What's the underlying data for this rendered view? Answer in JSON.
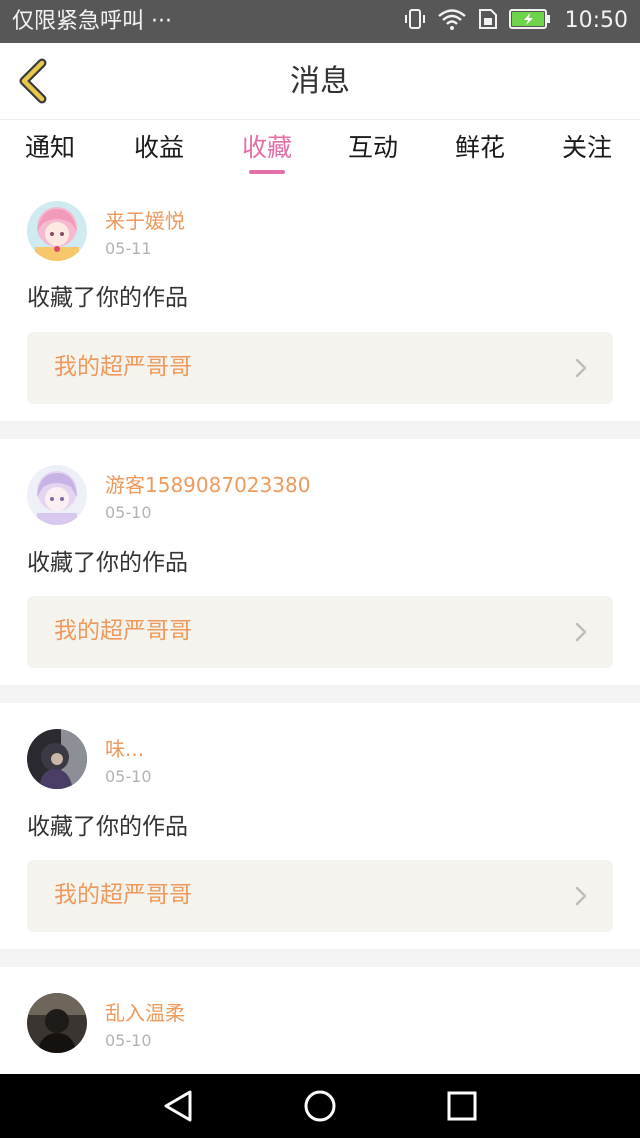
{
  "status_bar": {
    "left_text": "仅限紧急呼叫 ···",
    "time": "10:50",
    "icons": [
      "vibrate-icon",
      "wifi-icon",
      "sim-icon",
      "battery-charging-icon"
    ]
  },
  "header": {
    "title": "消息",
    "back_icon": "chevron-left-icon",
    "accent_color": "#e8c84a"
  },
  "tabs": [
    {
      "label": "通知",
      "active": false
    },
    {
      "label": "收益",
      "active": false
    },
    {
      "label": "收藏",
      "active": true
    },
    {
      "label": "互动",
      "active": false
    },
    {
      "label": "鲜花",
      "active": false
    },
    {
      "label": "关注",
      "active": false
    }
  ],
  "colors": {
    "active_tab": "#e36fa8",
    "username": "#ee9a5c",
    "work_box_bg": "#f5f3ee",
    "divider": "#f4f4f4"
  },
  "messages": [
    {
      "user": "来于媛悦",
      "date": "05-11",
      "action": "收藏了你的作品",
      "work": "我的超严哥哥",
      "avatar": "anime-pink-girl-avatar"
    },
    {
      "user": "游客1589087023380",
      "date": "05-10",
      "action": "收藏了你的作品",
      "work": "我的超严哥哥",
      "avatar": "anime-pastel-girl-avatar"
    },
    {
      "user": "味...",
      "date": "05-10",
      "action": "收藏了你的作品",
      "work": "我的超严哥哥",
      "avatar": "dark-photo-avatar"
    },
    {
      "user": "乱入温柔",
      "date": "05-10",
      "action": "",
      "work": "",
      "avatar": "dark-photo-avatar"
    }
  ],
  "nav_bar": {
    "icons": [
      "back-triangle-icon",
      "home-circle-icon",
      "recents-square-icon"
    ]
  }
}
